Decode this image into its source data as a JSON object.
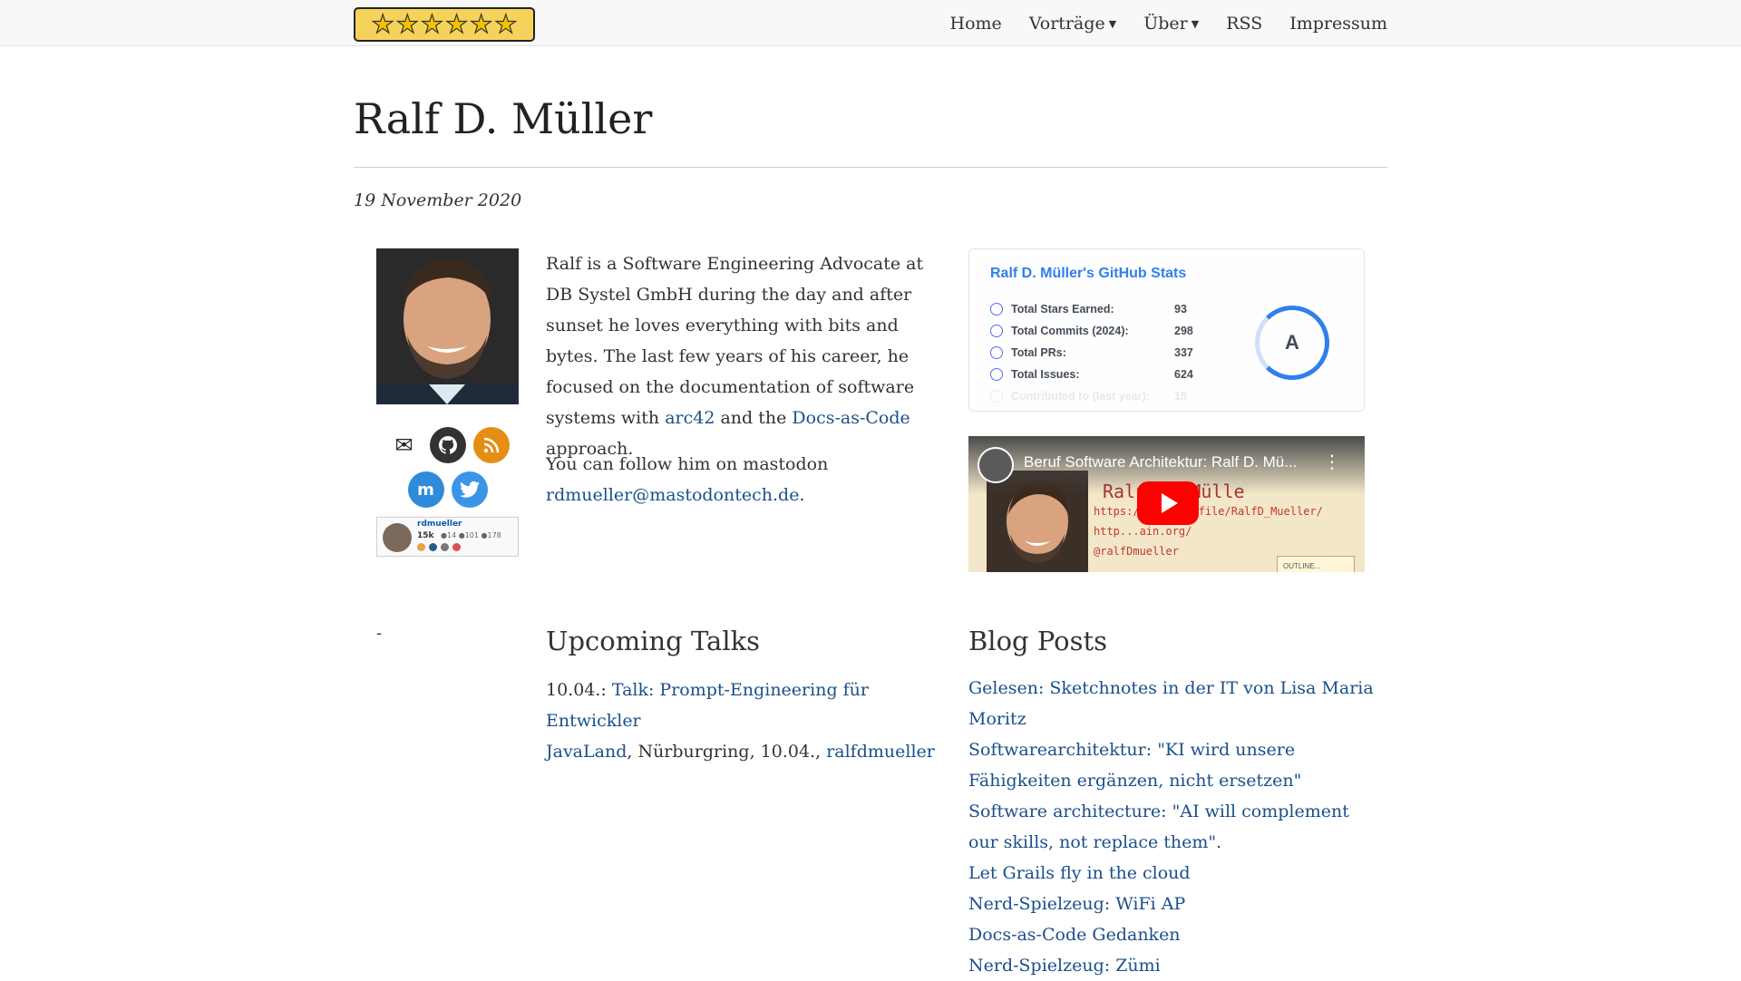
{
  "nav": {
    "home": "Home",
    "talks": "Vorträge",
    "about": "Über",
    "rss": "RSS",
    "imprint": "Impressum"
  },
  "page": {
    "title": "Ralf D. Müller",
    "date": "19 November 2020"
  },
  "bio": {
    "p1_a": "Ralf is a Software Engineering Advocate at DB Systel GmbH during the day and after sunset he loves everything with bits and bytes. The last few years of his career, he focused on the documentation of software systems with ",
    "arc42": "arc42",
    "p1_b": " and the ",
    "docs_as_code": "Docs-as-Code",
    "p1_c": " approach.",
    "follow_text": "You can follow him on mastodon ",
    "mastodon_handle": "rdmueller@mastodontech.de",
    "follow_end": "."
  },
  "stackoverflow": {
    "name": "rdmueller",
    "reputation": "15k",
    "badges": "●14 ●101 ●178"
  },
  "sidebar_dash": "-",
  "github_stats": {
    "title": "Ralf D. Müller's GitHub Stats",
    "rows": [
      {
        "label": "Total Stars Earned:",
        "value": "93"
      },
      {
        "label": "Total Commits (2024):",
        "value": "298"
      },
      {
        "label": "Total PRs:",
        "value": "337"
      },
      {
        "label": "Total Issues:",
        "value": "624"
      },
      {
        "label": "Contributed to (last year):",
        "value": "15"
      }
    ],
    "rank": "A"
  },
  "video": {
    "title": "Beruf Software Architektur: Ralf D. Mü...",
    "banner": "Ralf D. Mülle",
    "scribble_1": "https://w.../profile/RalfD_Mueller/",
    "scribble_2": "http...ain.org/",
    "scribble_3": "@ralfDmueller",
    "note": "OUTLINE..."
  },
  "talks": {
    "heading": "Upcoming Talks",
    "date_prefix": "10.04.: ",
    "title": "Talk: Prompt-Engineering für Entwickler",
    "venue": "JavaLand",
    "location": ", Nürburgring, 10.04., ",
    "speaker": "ralfdmueller"
  },
  "blog": {
    "heading": "Blog Posts",
    "posts": [
      "Gelesen: Sketchnotes in der IT von Lisa Maria Moritz",
      "Softwarearchitektur: \"KI wird unsere Fähigkeiten ergänzen, nicht ersetzen\"",
      "Software architecture: \"AI will complement our skills, not replace them\".",
      "Let Grails fly in the cloud",
      "Nerd-Spielzeug: WiFi AP",
      "Docs-as-Code Gedanken",
      "Nerd-Spielzeug: Zümi"
    ]
  }
}
